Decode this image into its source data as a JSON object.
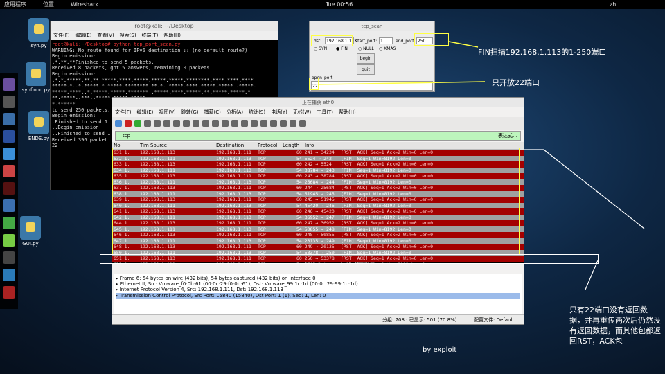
{
  "topbar": {
    "apps": "应用程序",
    "places": "位置",
    "wireshark": "Wireshark",
    "clock": "Tue 00:56",
    "lang": "zh"
  },
  "desktop": [
    "syn.py",
    "synflood.py",
    "ENDS.py",
    "GUI.py"
  ],
  "terminal": {
    "title": "root@kali: ~/Desktop",
    "menu": [
      "文件(F)",
      "编辑(E)",
      "查看(V)",
      "搜索(S)",
      "终端(T)",
      "帮助(H)"
    ],
    "lines": [
      "root@kali:~/Desktop# python tcp_port_scan.py",
      "WARNING: No route found for IPv6 destination :: (no default route?)",
      "Begin emission:",
      ".*.**.**Finished to send 5 packets.",
      "",
      "Received 8 packets, got 5 answers, remaining 0 packets",
      "Begin emission:",
      ".*.*.*****.**.**.*****.****.*****.*****.*****.********.**** ****.****",
      "*****.*..*.*****.*.*****.******** **.*. *****.****.*****.***** .*****.",
      "*****.****..*.*****.*****.******* .*****.****.*****.**.*****.*****.*",
      "**.*****..***..*****.*****.*****",
      "*.******",
      "to send 250 packets.",
      "Begin emission:",
      ".Finished to send 1",
      "..Begin emission:",
      "..Finished to send 1",
      "",
      "Received 396 packet",
      "22"
    ]
  },
  "scanner": {
    "title": "tcp_scan",
    "dst_label": "dst:",
    "dst": "192.168.1.113",
    "start_label": "start_port:",
    "start": "1",
    "end_label": "end_port:",
    "end": "250",
    "modes": [
      "SYN",
      "FIN",
      "NULL",
      "XMAS"
    ],
    "begin": "begin",
    "quit": "quit",
    "open_label": "open_port",
    "open": "22"
  },
  "wireshark": {
    "title": "正在捕获 eth0",
    "menu": [
      "文件(F)",
      "编辑(E)",
      "视图(V)",
      "跳转(G)",
      "捕获(C)",
      "分析(A)",
      "统计(S)",
      "电话(Y)",
      "无线(W)",
      "工具(T)",
      "帮助(H)"
    ],
    "filter": "tcp",
    "expr": "表达式…",
    "columns": [
      "No.",
      "Tim Source",
      "Destination",
      "Protocol",
      "Length",
      "Info"
    ],
    "rows": [
      [
        "631 1.",
        "192.168.1.113",
        "192.168.1.111",
        "TCP",
        "60 241 → 34234",
        "[RST, ACK] Seq=1 Ack=2 Win=0 Len=0",
        "rst"
      ],
      [
        "632 1.",
        "192.168.1.111",
        "192.168.1.113",
        "TCP",
        "54 5524 → 242",
        "[FIN] Seq=1 Win=8192 Len=0",
        "fin"
      ],
      [
        "633 1.",
        "192.168.1.113",
        "192.168.1.111",
        "TCP",
        "60 242 → 5524",
        "[RST, ACK] Seq=1 Ack=2 Win=0 Len=0",
        "rst"
      ],
      [
        "634 1.",
        "192.168.1.111",
        "192.168.1.113",
        "TCP",
        "54 38784 → 243",
        "[FIN] Seq=1 Win=8192 Len=0",
        "fin"
      ],
      [
        "635 1.",
        "192.168.1.113",
        "192.168.1.111",
        "TCP",
        "60 243 → 38784",
        "[RST, ACK] Seq=1 Ack=2 Win=0 Len=0",
        "rst"
      ],
      [
        "636 1.",
        "192.168.1.111",
        "192.168.1.113",
        "TCP",
        "54 25684 → 244",
        "[FIN] Seq=1 Win=8192 Len=0",
        "fin"
      ],
      [
        "637 1.",
        "192.168.1.113",
        "192.168.1.111",
        "TCP",
        "60 244 → 25684",
        "[RST, ACK] Seq=1 Ack=2 Win=0 Len=0",
        "rst"
      ],
      [
        "638 1.",
        "192.168.1.111",
        "192.168.1.113",
        "TCP",
        "54 51945 → 245",
        "[FIN] Seq=1 Win=8192 Len=0",
        "fin"
      ],
      [
        "639 1.",
        "192.168.1.113",
        "192.168.1.111",
        "TCP",
        "60 245 → 51945",
        "[RST, ACK] Seq=1 Ack=2 Win=0 Len=0",
        "rst"
      ],
      [
        "640 1.",
        "192.168.1.111",
        "192.168.1.113",
        "TCP",
        "54 45420 → 246",
        "[FIN] Seq=1 Win=8192 Len=0",
        "fin"
      ],
      [
        "641 1.",
        "192.168.1.113",
        "192.168.1.111",
        "TCP",
        "60 246 → 45420",
        "[RST, ACK] Seq=1 Ack=2 Win=0 Len=0",
        "rst"
      ],
      [
        "642 1.",
        "192.168.1.111",
        "192.168.1.113",
        "TCP",
        "54 36952 → 247",
        "[FIN] Seq=1 Win=8192 Len=0",
        "fin"
      ],
      [
        "644 1.",
        "192.168.1.113",
        "192.168.1.111",
        "TCP",
        "60 247 → 36952",
        "[RST, ACK] Seq=1 Ack=2 Win=0 Len=0",
        "rst"
      ],
      [
        "645 1.",
        "192.168.1.111",
        "192.168.1.113",
        "TCP",
        "54 50855 → 248",
        "[FIN] Seq=1 Win=8192 Len=0",
        "fin"
      ],
      [
        "646 1.",
        "192.168.1.113",
        "192.168.1.111",
        "TCP",
        "60 248 → 50855",
        "[RST, ACK] Seq=1 Ack=2 Win=0 Len=0",
        "rst"
      ],
      [
        "647 1.",
        "192.168.1.111",
        "192.168.1.113",
        "TCP",
        "54 20135 → 249",
        "[FIN] Seq=1 Win=8192 Len=0",
        "fin"
      ],
      [
        "648 1.",
        "192.168.1.113",
        "192.168.1.111",
        "TCP",
        "60 249 → 20135",
        "[RST, ACK] Seq=1 Ack=2 Win=0 Len=0",
        "rst"
      ],
      [
        "650 1.",
        "192.168.1.111",
        "192.168.1.113",
        "TCP",
        "54 53378 → 250",
        "[FIN] Seq=1 Win=8192 Len=0",
        "fin"
      ],
      [
        "651 1.",
        "192.168.1.113",
        "192.168.1.111",
        "TCP",
        "60 250 → 53378",
        "[RST, ACK] Seq=1 Ack=2 Win=0 Len=0",
        "rst"
      ],
      [
        "652 1.",
        "192.168.1.111",
        "192.168.1.113",
        "TCP",
        "54 [TCP Retransmission] 39198",
        "→ 22 [FIN] Seq=1 Win=8192 Len=0",
        "sel"
      ],
      [
        "658 1.",
        "192.168.1.111",
        "192.168.1.113",
        "TCP",
        "54 [TCP Retransmission] 39198",
        "→ 22 [FIN] Seq=1 Win=8192 Len=0",
        "sel"
      ]
    ],
    "details": [
      "Frame 6: 54 bytes on wire (432 bits), 54 bytes captured (432 bits) on interface 0",
      "Ethernet II, Src: Vmware_f0:0b:61 (00:0c:29:f0:0b:61), Dst: Vmware_99:1c:1d (00:0c:29:99:1c:1d)",
      "Internet Protocol Version 4, Src: 192.168.1.111, Dst: 192.168.1.113",
      "Transmission Control Protocol, Src Port: 15840 (15840), Dst Port: 1 (1), Seq: 1, Len: 0"
    ],
    "status_pkts": "分组: 708 · 已显示: 501 (70.8%)",
    "status_profile": "配置文件: Default"
  },
  "annotations": {
    "a1": "FIN扫描192.168.1.113的1-250端口",
    "a2": "只开放22端口",
    "a3": "只有22端口没有返回数据，并再重传两次后仍然没有返回数据，而其他包都返回RST，ACK包",
    "sig": "by exploit"
  }
}
